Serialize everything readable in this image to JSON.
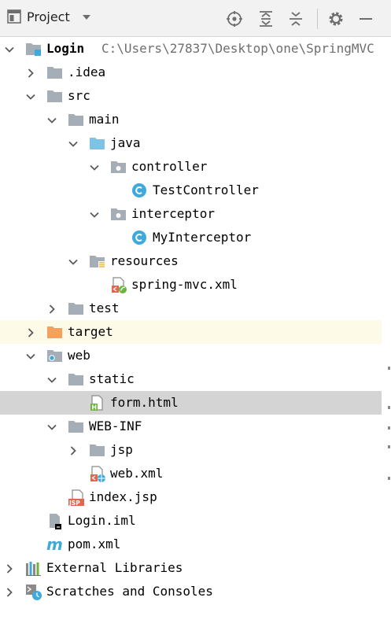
{
  "toolbar": {
    "title": "Project",
    "icons": [
      "locate-icon",
      "expand-all-icon",
      "collapse-all-icon",
      "gear-icon",
      "minimize-icon"
    ]
  },
  "tree": {
    "root_label": "Login",
    "root_path": "C:\\Users\\27837\\Desktop\\one\\SpringMVC",
    "idea": ".idea",
    "src": "src",
    "main": "main",
    "java": "java",
    "controller": "controller",
    "test_controller": "TestController",
    "interceptor": "interceptor",
    "my_interceptor": "MyInterceptor",
    "resources": "resources",
    "spring_mvc_xml": "spring-mvc.xml",
    "test": "test",
    "target": "target",
    "web": "web",
    "static": "static",
    "form_html": "form.html",
    "web_inf": "WEB-INF",
    "jsp": "jsp",
    "web_xml": "web.xml",
    "index_jsp": "index.jsp",
    "login_iml": "Login.iml",
    "pom_xml": "pom.xml",
    "external_libraries": "External Libraries",
    "scratches": "Scratches and Consoles"
  },
  "colors": {
    "folder_grey": "#a5aeb6",
    "folder_source": "#7ec3e6",
    "folder_target": "#f3a15e",
    "class_icon": "#3fa9dc",
    "selection": "#d4d4d4",
    "excluded_highlight": "#fdfbe8"
  }
}
